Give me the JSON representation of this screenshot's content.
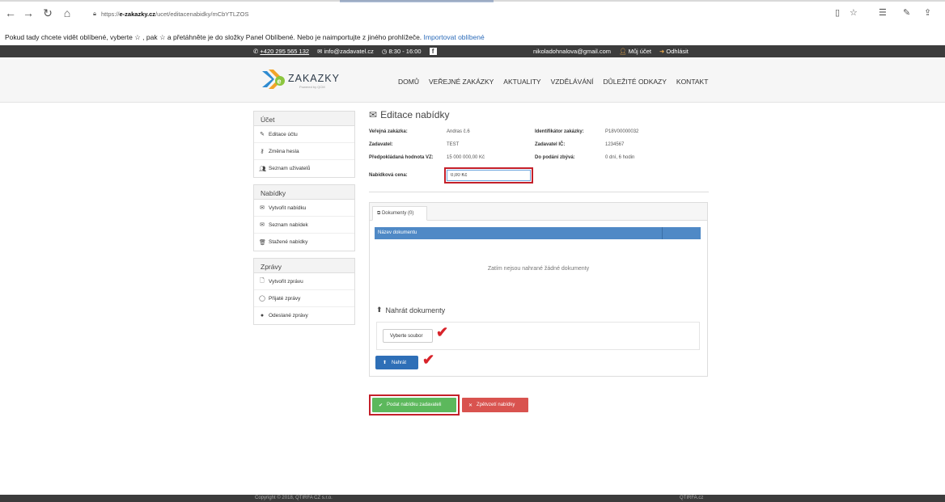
{
  "browser": {
    "url_prefix": "https://",
    "url_host": "e-zakazky.cz",
    "url_path": "/ucet/editacenabidky/mCbYTLZOS"
  },
  "favbar": {
    "message": "Pokud tady chcete vidět oblíbené, vyberte ☆ , pak ☆ a přetáhněte je do složky Panel Oblíbené. Nebo je naimportujte z jiného prohlížeče.",
    "import_link": "Importovat oblíbené"
  },
  "topbar": {
    "phone": "+420 295 565 132",
    "email": "info@zadavatel.cz",
    "hours": "8:30 - 16:00",
    "user_email": "nikoladohnalova@gmail.com",
    "account": "Můj účet",
    "logout": "Odhlásit"
  },
  "header": {
    "logo_text": "ZAKAZKY",
    "logo_sub": "Powered by QCM",
    "nav": [
      "DOMŮ",
      "VEŘEJNÉ ZAKÁZKY",
      "AKTUALITY",
      "VZDĚLÁVÁNÍ",
      "DŮLEŽITÉ ODKAZY",
      "KONTAKT"
    ]
  },
  "sidebar": {
    "account": {
      "title": "Účet",
      "items": [
        "Editace účtu",
        "Změna hesla",
        "Seznam uživatelů"
      ]
    },
    "offers": {
      "title": "Nabídky",
      "items": [
        "Vytvořit nabídku",
        "Seznam nabídek",
        "Stažené nabídky"
      ]
    },
    "messages": {
      "title": "Zprávy",
      "items": [
        "Vytvořit zprávu",
        "Přijaté zprávy",
        "Odeslané zprávy"
      ]
    }
  },
  "main": {
    "title": "Editace nabídky",
    "fields": {
      "contract_label": "Veřejná zakázka:",
      "contract_value": "Andras č.6",
      "contracting_label": "Zadavatel:",
      "contracting_value": "TEST",
      "estimate_label": "Předpokládaná hodnota VZ:",
      "estimate_value": "15 000 000,00 Kč",
      "id_label": "Identifikátor zakázky:",
      "id_value": "P18V00000032",
      "ic_label": "Zadavatel IČ:",
      "ic_value": "1234567",
      "deadline_label": "Do podání zbývá:",
      "deadline_value": "0 dní, 6 hodin",
      "price_label": "Nabídková cena:",
      "price_value": "0,00 Kč"
    },
    "documents": {
      "tab_label": "Dokumenty (0)",
      "column_name": "Název dokumentu",
      "empty_text": "Zatím nejsou nahrané žádné dokumenty",
      "upload_title": "Nahrát dokumenty",
      "choose_file": "Vyberte soubor",
      "upload_button": "Nahrát"
    },
    "submit_button": "Podat nabídku zadavateli",
    "withdraw_button": "Zpětvzetí nabídky"
  },
  "footer": {
    "copyright": "Copyright © 2018, QTIRFA CZ s.r.o.",
    "right": "QTIRFA.cz"
  },
  "colors": {
    "accent_blue": "#2e6fb7",
    "success_green": "#5cb85c",
    "danger_red": "#d9534f",
    "highlight_red": "#c4202a"
  }
}
